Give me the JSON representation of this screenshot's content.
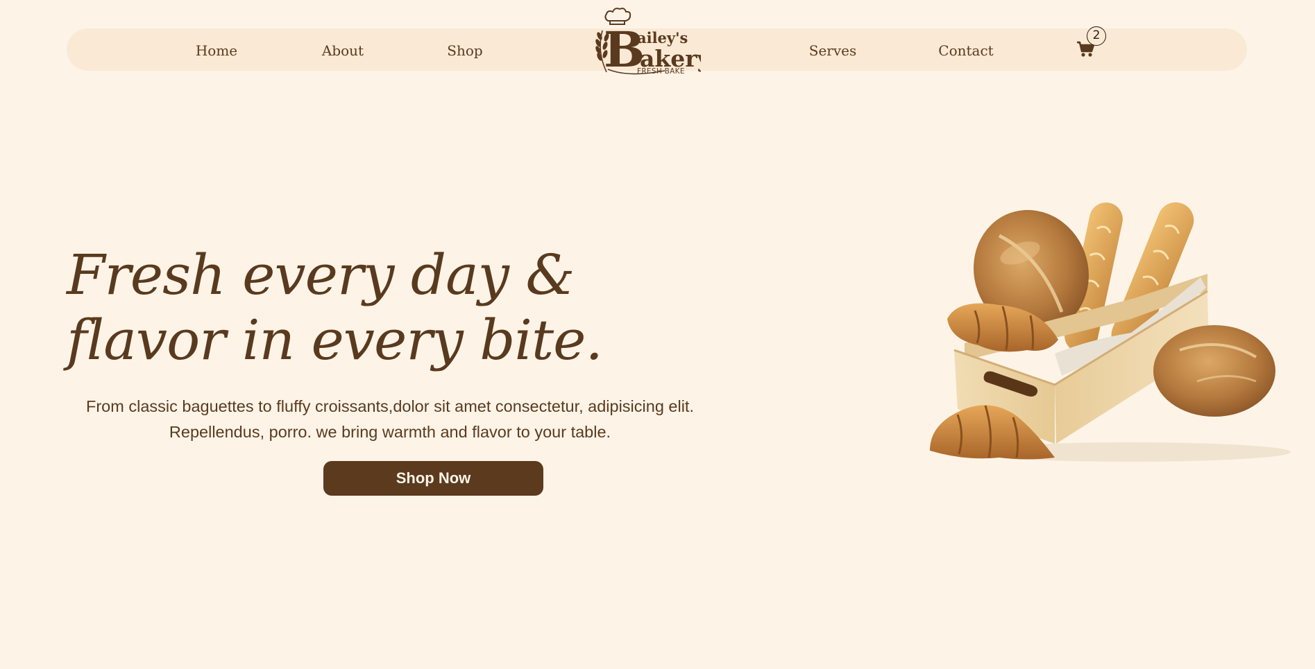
{
  "nav": {
    "home": "Home",
    "about": "About",
    "shop": "Shop",
    "serves": "Serves",
    "contact": "Contact"
  },
  "logo": {
    "name_upper": "ailey's",
    "name_lower": "akery",
    "initial": "B",
    "tagline": "FRESH BAKE"
  },
  "cart": {
    "count": "2",
    "icon": "cart-icon"
  },
  "hero": {
    "title": "Fresh every day & flavor in every bite.",
    "description": "From classic baguettes to fluffy croissants,dolor sit amet consectetur, adipisicing elit. Repellendus, porro. we bring warmth and flavor to your table.",
    "button_label": "Shop Now"
  },
  "colors": {
    "background": "#fdf4e7",
    "navbar": "#fae9d5",
    "brand_brown": "#5c3a1e"
  }
}
